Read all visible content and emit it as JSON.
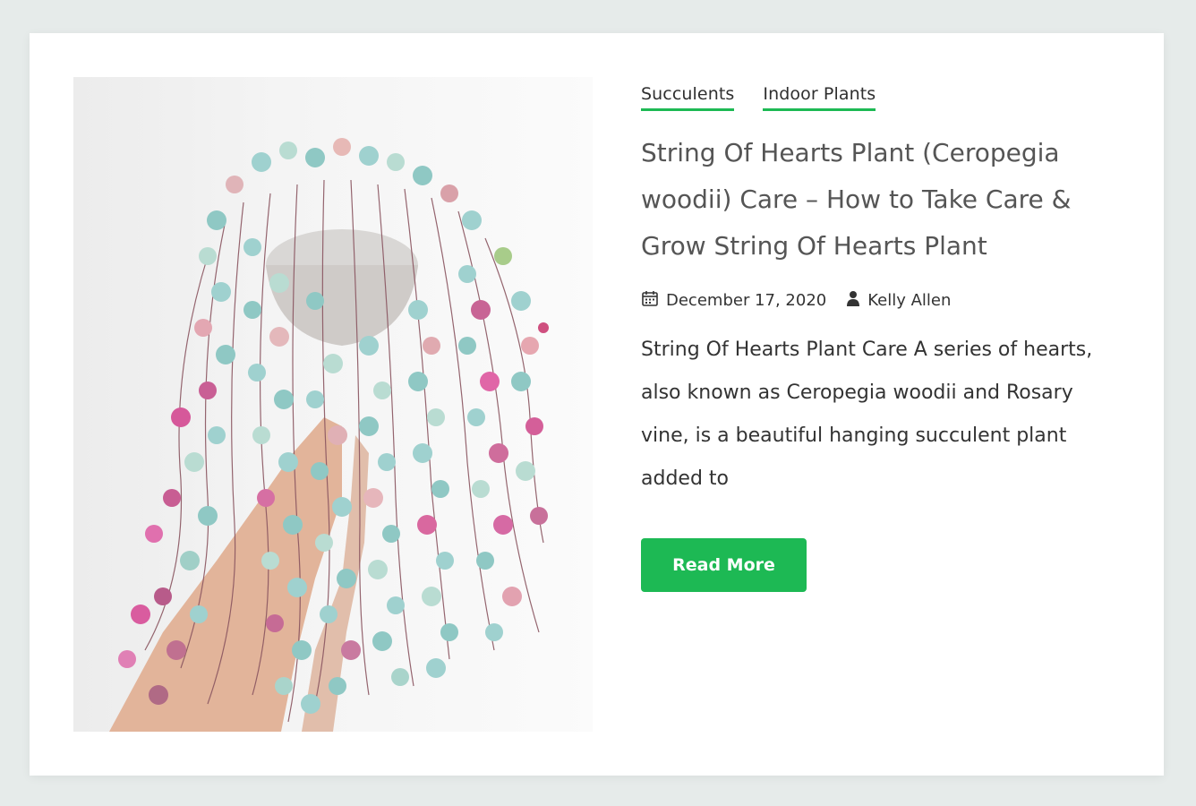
{
  "post": {
    "categories": [
      "Succulents",
      "Indoor Plants"
    ],
    "title": "String Of Hearts Plant (Ceropegia woodii) Care – How to Take Care & Grow String Of Hearts Plant",
    "date": "December 17, 2020",
    "author": "Kelly Allen",
    "excerpt": "String Of Hearts Plant Care A series of hearts, also known as Ceropegia woodii and Rosary vine, is a beautiful hanging succulent plant added to",
    "read_more_label": "Read More"
  },
  "icons": {
    "date": "calendar-icon",
    "author": "user-icon"
  },
  "colors": {
    "accent": "#1db954",
    "title": "#555555",
    "text": "#333333",
    "background": "#e6ebea",
    "card": "#ffffff"
  }
}
